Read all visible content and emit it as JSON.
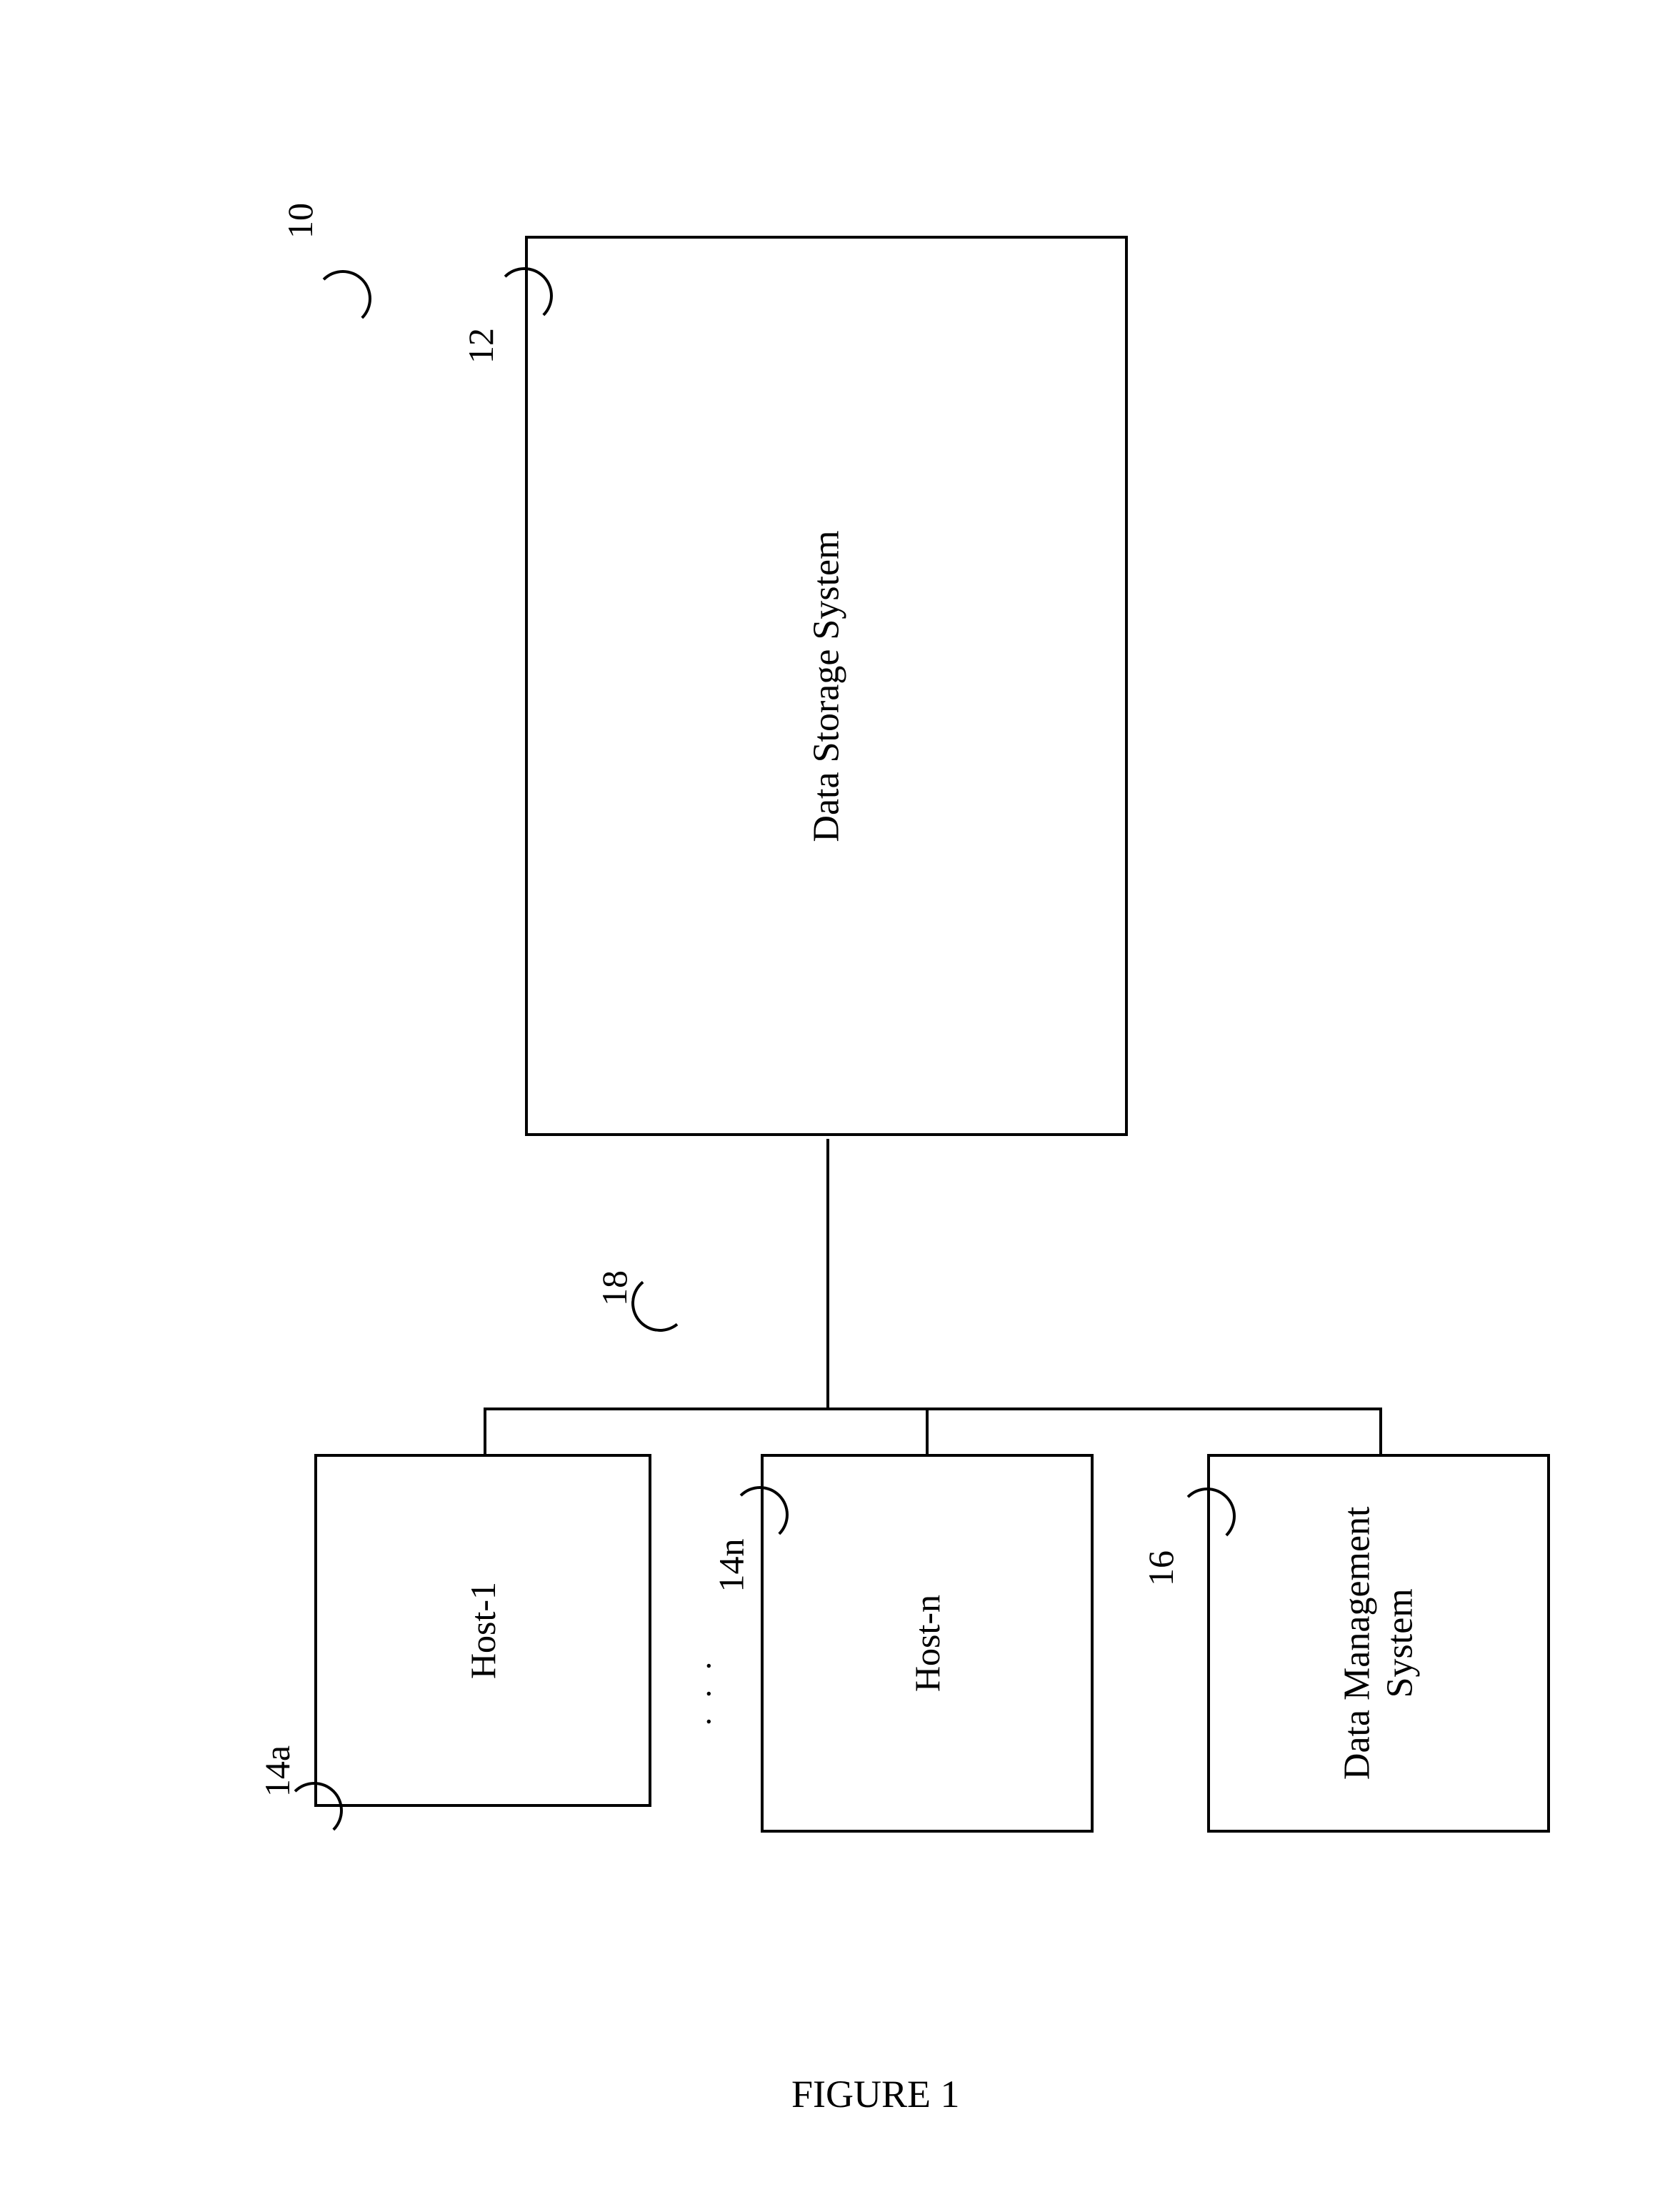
{
  "figure_caption": "FIGURE 1",
  "overall_ref": "10",
  "data_storage_system": {
    "label": "Data Storage System",
    "ref": "12"
  },
  "bus": {
    "ref": "18"
  },
  "hosts": {
    "first": {
      "label": "Host-1",
      "ref": "14a"
    },
    "ellipsis": ". . .",
    "nth": {
      "label": "Host-n",
      "ref": "14n"
    }
  },
  "data_management_system": {
    "label_line1": "Data Management",
    "label_line2": "System",
    "ref": "16"
  }
}
